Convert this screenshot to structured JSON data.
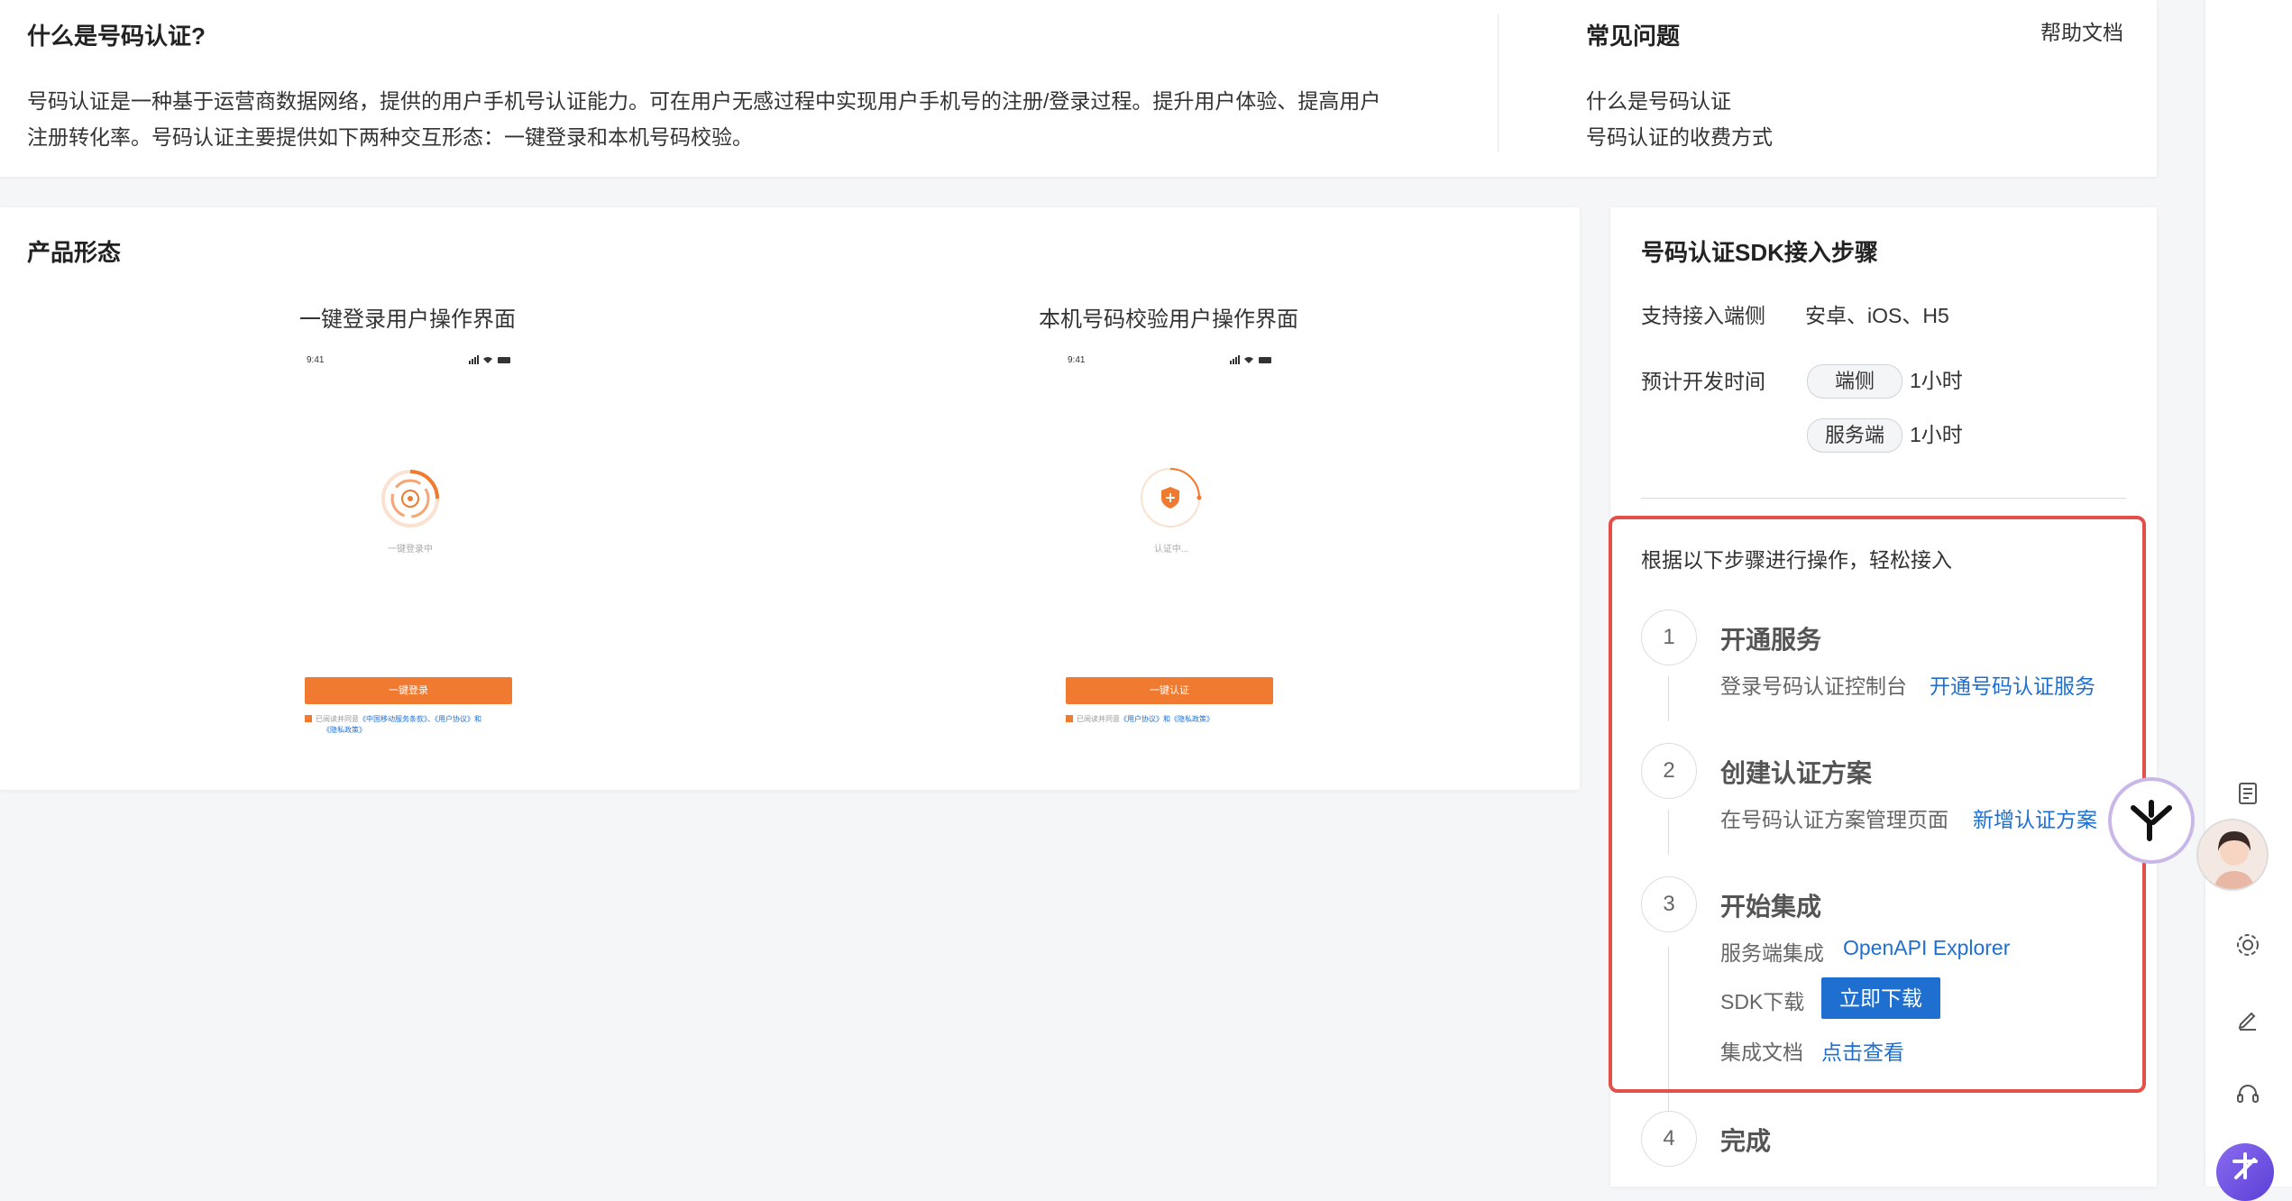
{
  "intro": {
    "title": "什么是号码认证?",
    "line1": "号码认证是一种基于运营商数据网络，提供的用户手机号认证能力。可在用户无感过程中实现用户手机号的注册/登录过程。提升用户体验、提高用户",
    "line2": "注册转化率。号码认证主要提供如下两种交互形态：一键登录和本机号码校验。"
  },
  "faq": {
    "title": "常见问题",
    "help_link": "帮助文档",
    "items": [
      "什么是号码认证",
      "号码认证的收费方式"
    ]
  },
  "product": {
    "title": "产品形态",
    "left": {
      "caption": "一键登录用户操作界面",
      "time": "9:41",
      "loading": "一键登录中",
      "button": "一键登录",
      "agree_prefix": "已阅读并同意",
      "agree_links": "《中国移动服务条款》、《用户协议》和",
      "agree_line2": "《隐私政策》"
    },
    "right": {
      "caption": "本机号码校验用户操作界面",
      "time": "9:41",
      "loading": "认证中...",
      "button": "一键认证",
      "agree_prefix": "已阅读并同意",
      "agree_links": "《用户协议》和《隐私政策》"
    }
  },
  "sdk": {
    "title": "号码认证SDK接入步骤",
    "support_label": "支持接入端侧",
    "support_value": "安卓、iOS、H5",
    "dev_time_label": "预计开发时间",
    "client_tag": "端侧",
    "client_time": "1小时",
    "server_tag": "服务端",
    "server_time": "1小时",
    "intro": "根据以下步骤进行操作，轻松接入",
    "steps": [
      {
        "num": "1",
        "title": "开通服务",
        "desc": "登录号码认证控制台",
        "link": "开通号码认证服务"
      },
      {
        "num": "2",
        "title": "创建认证方案",
        "desc": "在号码认证方案管理页面",
        "link": "新增认证方案"
      },
      {
        "num": "3",
        "title": "开始集成",
        "server_label": "服务端集成",
        "server_link": "OpenAPI Explorer",
        "sdk_label": "SDK下载",
        "sdk_button": "立即下载",
        "doc_label": "集成文档",
        "doc_link": "点击查看"
      },
      {
        "num": "4",
        "title": "完成"
      }
    ]
  },
  "colors": {
    "accent": "#f07a2f",
    "link": "#1f6fd1",
    "highlight_border": "#e3504a"
  },
  "toolbar_icons": [
    "checklist-icon",
    "assistant-avatar-icon",
    "settings-gear-icon",
    "edit-pen-icon",
    "headset-support-icon",
    "brand-logo-icon"
  ]
}
